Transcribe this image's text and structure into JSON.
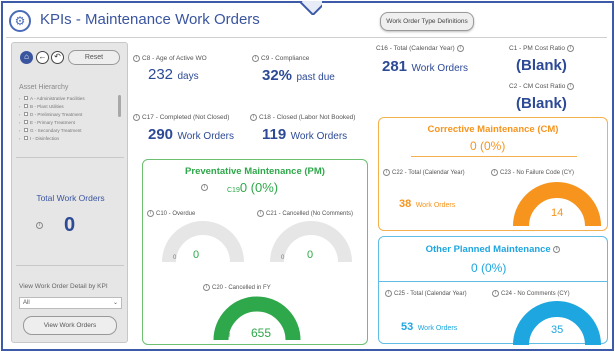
{
  "header": {
    "title": "KPIs - Maintenance Work Orders",
    "definitions_button": "Work Order Type Definitions"
  },
  "sidebar": {
    "reset_label": "Reset",
    "asset_hierarchy_label": "Asset Hierarchy",
    "asset_items": [
      "A - Administrative Facilities",
      "B - Plant Utilities",
      "D - Preliminary Treatment",
      "E - Primary Treatment",
      "G - Secondary Treatment",
      "I - Disinfection"
    ],
    "total_wo_label": "Total Work Orders",
    "total_wo_value": "0",
    "view_detail_label": "View Work Order Detail by KPI",
    "detail_select_value": "All",
    "view_button": "View Work Orders"
  },
  "kpis": {
    "c8_label": "C8 - Age of Active WO",
    "c8_value": "232",
    "c8_unit": "days",
    "c9_label": "C9 - Compliance",
    "c9_value": "32%",
    "c9_unit": "past due",
    "c16_label": "C16 - Total (Calendar Year)",
    "c16_value": "281",
    "c16_unit": "Work Orders",
    "c1_label": "C1 - PM Cost Ratio",
    "c1_value": "(Blank)",
    "c2_label": "C2 - CM Cost Ratio",
    "c2_value": "(Blank)",
    "c17_label": "C17 - Completed (Not Closed)",
    "c17_value": "290",
    "c17_unit": "Work Orders",
    "c18_label": "C18 - Closed (Labor Not Booked)",
    "c18_value": "119",
    "c18_unit": "Work Orders"
  },
  "pm": {
    "title": "Preventative Maintenance (PM)",
    "c19_label": "C19",
    "c19_value": "0 (0%)",
    "c10_label": "C10 - Overdue",
    "c10_value": "0",
    "c10_min": "0",
    "c10_fraction": 0,
    "c21_label": "C21 - Cancelled (No Comments)",
    "c21_value": "0",
    "c21_min": "0",
    "c21_fraction": 0,
    "c20_label": "C20 - Cancelled in FY",
    "c20_value": "655",
    "c20_min": "0",
    "c20_fraction": 1
  },
  "cm": {
    "title": "Corrective Maintenance (CM)",
    "pct": "0 (0%)",
    "c22_label": "C22 - Total (Calendar Year)",
    "c22_value": "38",
    "c22_unit": "Work Orders",
    "c23_label": "C23 - No Failure Code (CY)",
    "c23_value": "14",
    "c23_fraction": 1
  },
  "op": {
    "title": "Other Planned Maintenance",
    "pct": "0 (0%)",
    "c25_label": "C25 - Total (Calendar Year)",
    "c25_value": "53",
    "c25_unit": "Work Orders",
    "c24_label": "C24 - No Comments (CY)",
    "c24_value": "35",
    "c24_fraction": 1
  },
  "colors": {
    "accent": "#3a55a0",
    "pm_green": "#2ea84a",
    "cm_orange": "#f7941d",
    "op_blue": "#1ea6e0",
    "gauge_track": "#e6e6e6"
  }
}
